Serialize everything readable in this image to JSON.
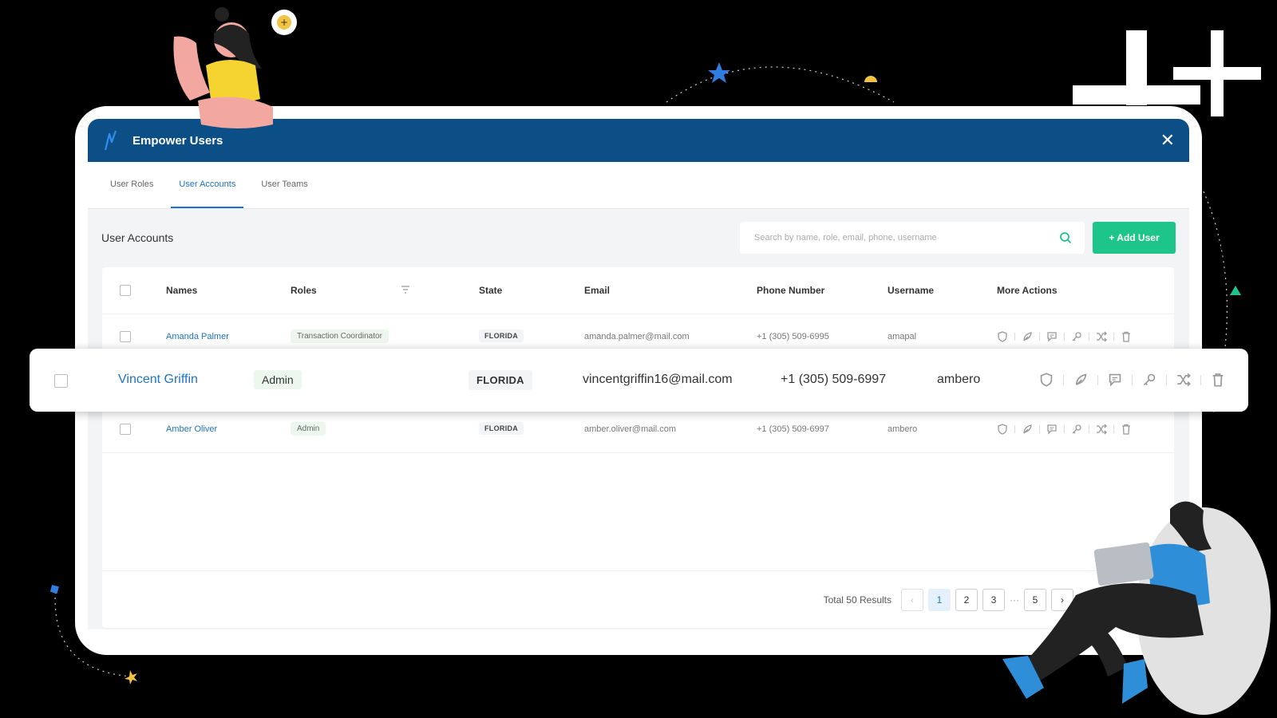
{
  "colors": {
    "header": "#0b4f86",
    "accent": "#1d73c4",
    "add_button": "#1ec58b"
  },
  "modal": {
    "title": "Empower Users",
    "close_icon": "close-icon"
  },
  "tabs": [
    {
      "label": "User Roles"
    },
    {
      "label": "User Accounts",
      "active": true
    },
    {
      "label": "User Teams"
    }
  ],
  "section": {
    "title": "User Accounts"
  },
  "search": {
    "placeholder": "Search by name, role, email, phone, username"
  },
  "add_button": {
    "label": "+ Add User"
  },
  "table": {
    "columns": [
      "Names",
      "Roles",
      "State",
      "Email",
      "Phone Number",
      "Username",
      "More Actions"
    ],
    "rows": [
      {
        "name": "Amanda Palmer",
        "role": "Transaction Coordinator",
        "state": "FLORIDA",
        "email": "amanda.palmer@mail.com",
        "phone": "+1 (305) 509-6995",
        "username": "amapal"
      },
      {
        "name": "Vincent Griffin",
        "role": "Admin",
        "state": "FLORIDA",
        "email": "vincentgriffin16@mail.com",
        "phone": "+1 (305) 509-6997",
        "username": "ambero"
      },
      {
        "name": "Amber Oliver",
        "role": "Admin",
        "state": "FLORIDA",
        "email": "amber.oliver@mail.com",
        "phone": "+1 (305) 509-6997",
        "username": "ambero"
      }
    ],
    "row_actions": [
      "shield-icon",
      "feather-icon",
      "comment-icon",
      "key-icon",
      "shuffle-icon",
      "trash-icon"
    ]
  },
  "pagination": {
    "total": "Total 50 Results",
    "pages": [
      "1",
      "2",
      "3",
      "5"
    ],
    "ellipsis": "···",
    "current": "1"
  }
}
